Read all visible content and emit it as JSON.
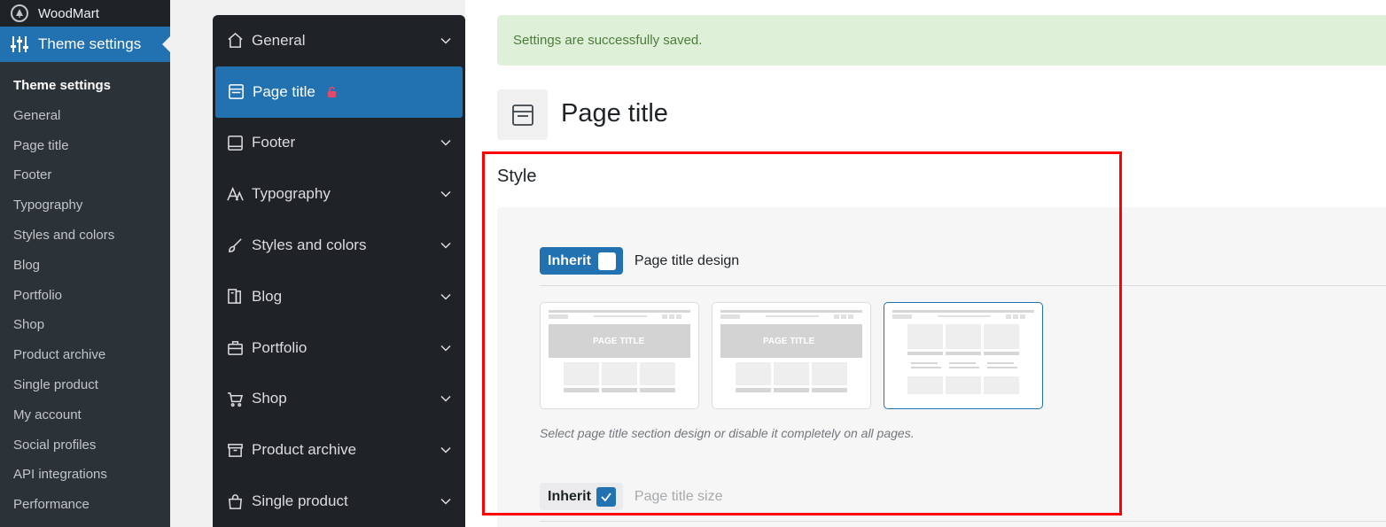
{
  "wp_sidebar": {
    "brand": "WoodMart",
    "current_menu": "Theme settings",
    "submenu": [
      "Theme settings",
      "General",
      "Page title",
      "Footer",
      "Typography",
      "Styles and colors",
      "Blog",
      "Portfolio",
      "Shop",
      "Product archive",
      "Single product",
      "My account",
      "Social profiles",
      "API integrations",
      "Performance"
    ]
  },
  "theme_nav": {
    "items": [
      {
        "label": "General",
        "icon": "home-icon",
        "active": false
      },
      {
        "label": "Page title",
        "icon": "window-icon",
        "active": true
      },
      {
        "label": "Footer",
        "icon": "footer-icon",
        "active": false
      },
      {
        "label": "Typography",
        "icon": "typography-icon",
        "active": false
      },
      {
        "label": "Styles and colors",
        "icon": "brush-icon",
        "active": false
      },
      {
        "label": "Blog",
        "icon": "book-icon",
        "active": false
      },
      {
        "label": "Portfolio",
        "icon": "briefcase-icon",
        "active": false
      },
      {
        "label": "Shop",
        "icon": "cart-icon",
        "active": false
      },
      {
        "label": "Product archive",
        "icon": "archive-icon",
        "active": false
      },
      {
        "label": "Single product",
        "icon": "bag-icon",
        "active": false
      }
    ]
  },
  "main": {
    "notice": "Settings are successfully saved.",
    "page_title": "Page title",
    "section_title": "Style",
    "design_field": {
      "inherit_label": "Inherit",
      "inherit_checked": false,
      "label": "Page title design",
      "options": [
        {
          "caption": "PAGE TITLE",
          "selected": false
        },
        {
          "caption": "PAGE TITLE",
          "selected": false
        },
        {
          "caption": "",
          "selected": true
        }
      ],
      "hint": "Select page title section design or disable it completely on all pages."
    },
    "size_field": {
      "inherit_label": "Inherit",
      "inherit_checked": true,
      "label": "Page title size"
    }
  },
  "colors": {
    "wp_sidebar": "#1d2327",
    "accent": "#2271b1",
    "notice_bg": "#dff0d8",
    "highlight": "#ff0000"
  }
}
